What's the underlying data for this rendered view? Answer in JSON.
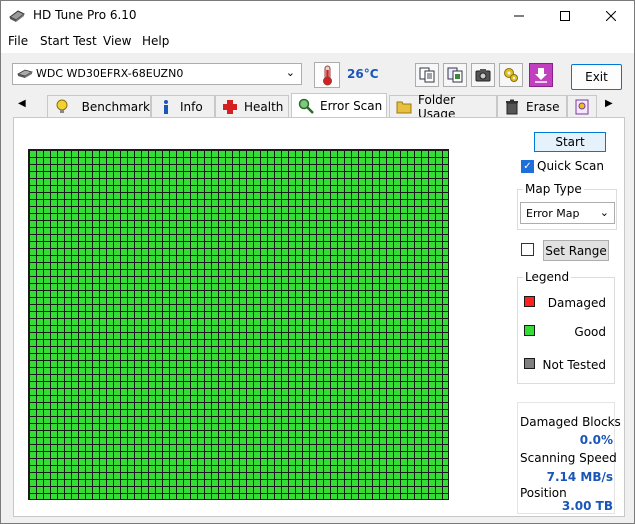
{
  "window": {
    "title": "HD Tune Pro 6.10"
  },
  "menu": [
    "File",
    "Start Test",
    "View",
    "Help"
  ],
  "toolbar": {
    "drive": "WDC WD30EFRX-68EUZN0",
    "temperature": "26°C",
    "exit_label": "Exit"
  },
  "tabs": [
    "Benchmark",
    "Info",
    "Health",
    "Error Scan",
    "Folder Usage",
    "Erase"
  ],
  "active_tab": "Error Scan",
  "scan": {
    "start_label": "Start",
    "quick_scan_label": "Quick Scan",
    "quick_scan_checked": true,
    "map_type_title": "Map Type",
    "map_type_value": "Error Map",
    "range_checked": false,
    "set_range_label": "Set Range",
    "legend_title": "Legend",
    "legend": [
      {
        "label": "Damaged",
        "color": "#ff2020"
      },
      {
        "label": "Good",
        "color": "#33dd33"
      },
      {
        "label": "Not Tested",
        "color": "#808080"
      }
    ],
    "block_color": "#33dd33",
    "stats": {
      "damaged_blocks_label": "Damaged Blocks",
      "damaged_blocks_value": "0.0%",
      "speed_label": "Scanning Speed",
      "speed_value": "7.14 MB/s",
      "position_label": "Position",
      "position_value": "3.00 TB"
    }
  }
}
